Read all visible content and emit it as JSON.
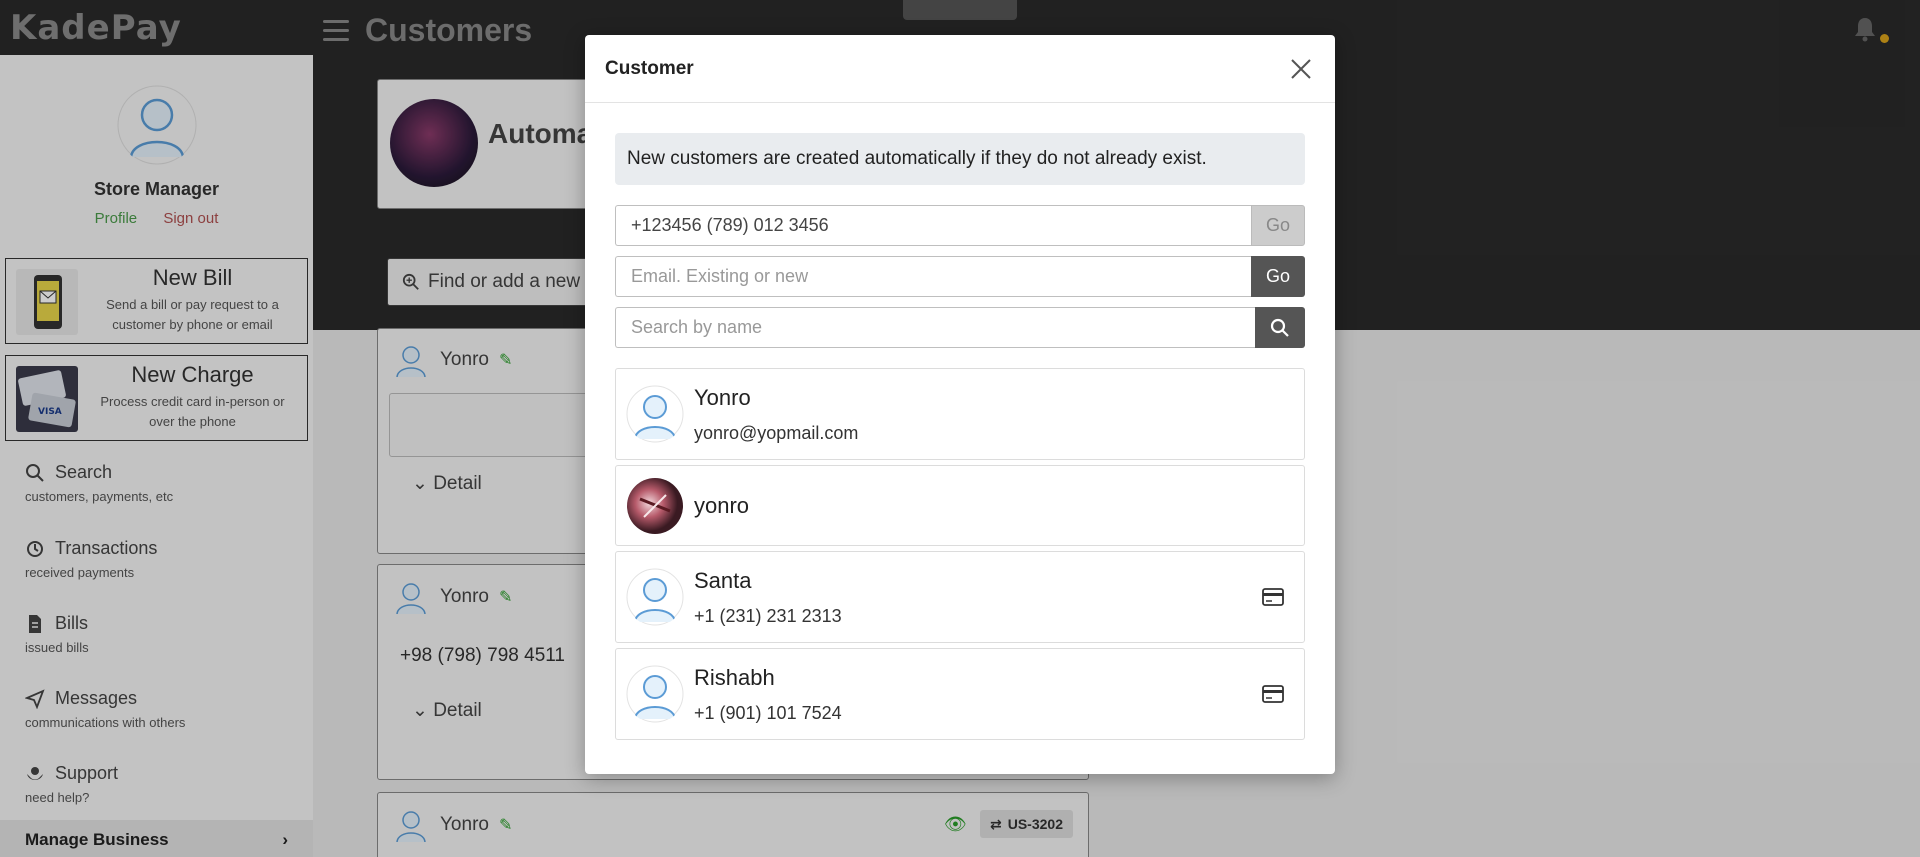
{
  "app": {
    "logo": "KadePay",
    "page_title": "Customers"
  },
  "sidebar": {
    "store_name": "Store Manager",
    "profile_link": "Profile",
    "signout_link": "Sign out",
    "new_bill": {
      "title": "New Bill",
      "subtitle": "Send a bill or pay request to a customer by phone or email"
    },
    "new_charge": {
      "title": "New Charge",
      "subtitle": "Process credit card in-person or over the phone"
    },
    "nav": [
      {
        "label": "Search",
        "sub": "customers, payments, etc",
        "icon": "search-icon"
      },
      {
        "label": "Transactions",
        "sub": "received payments",
        "icon": "history-icon"
      },
      {
        "label": "Bills",
        "sub": "issued bills",
        "icon": "document-icon"
      },
      {
        "label": "Messages",
        "sub": "communications with others",
        "icon": "send-icon"
      },
      {
        "label": "Support",
        "sub": "need help?",
        "icon": "support-icon"
      }
    ],
    "manage_business": "Manage Business"
  },
  "background": {
    "automation_title": "Automa",
    "find_placeholder": "Find or add a new c",
    "customers": [
      {
        "name": "Yonro"
      },
      {
        "name": "Yonro",
        "phone": "+98 (798) 798 4511"
      },
      {
        "name": "Yonro",
        "tag": "US-3202"
      }
    ],
    "detail_label": "Detail"
  },
  "modal": {
    "title": "Customer",
    "info_text": "New customers are created automatically if they do not already exist.",
    "phone_input": {
      "value": "+123456 (789) 012 3456",
      "go_label": "Go"
    },
    "email_input": {
      "placeholder": "Email. Existing or new",
      "go_label": "Go"
    },
    "name_input": {
      "placeholder": "Search by name"
    },
    "results": [
      {
        "name": "Yonro",
        "detail": "yonro@yopmail.com",
        "avatar": "default",
        "card": false
      },
      {
        "name": "yonro",
        "detail": "",
        "avatar": "photo",
        "card": false
      },
      {
        "name": "Santa",
        "detail": "+1 (231) 231 2313",
        "avatar": "default",
        "card": true
      },
      {
        "name": "Rishabh",
        "detail": "+1 (901) 101 7524",
        "avatar": "default",
        "card": true
      }
    ]
  },
  "colors": {
    "accent_green": "#2a9d2a",
    "dark_bar": "#2a2a2a",
    "button_dark": "#555555"
  }
}
